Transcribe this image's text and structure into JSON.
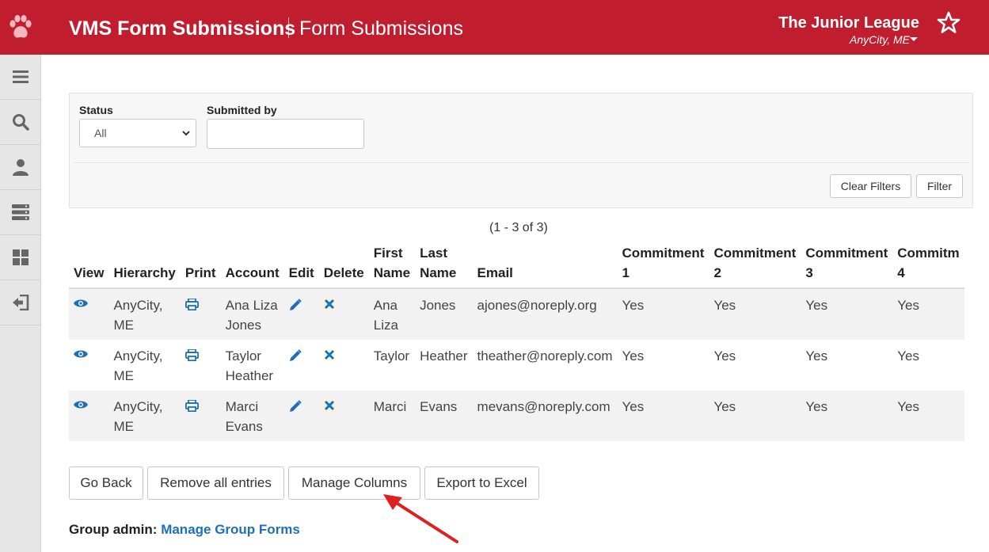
{
  "header": {
    "app_title": "VMS Form Submissions",
    "page_title": "Form Submissions",
    "org_name": "The Junior League",
    "org_city": "AnyCity, ME"
  },
  "sidebar": {
    "icons": [
      "menu-icon",
      "search-icon",
      "user-icon",
      "server-icon",
      "dashboard-icon",
      "logout-icon"
    ]
  },
  "filters": {
    "status_label": "Status",
    "status_value": "All",
    "submitted_by_label": "Submitted by",
    "submitted_by_value": "",
    "clear_label": "Clear Filters",
    "filter_label": "Filter"
  },
  "results_count": "(1 - 3 of 3)",
  "table": {
    "headers": {
      "view": "View",
      "hierarchy": "Hierarchy",
      "print": "Print",
      "account": "Account",
      "edit": "Edit",
      "delete": "Delete",
      "first_1": "First",
      "first_2": "Name",
      "last_1": "Last",
      "last_2": "Name",
      "email": "Email",
      "c1_1": "Commitment",
      "c1_2": "1",
      "c2_1": "Commitment",
      "c2_2": "2",
      "c3_1": "Commitment",
      "c3_2": "3",
      "c4_1": "Commitm",
      "c4_2": "4"
    },
    "rows": [
      {
        "hier_1": "AnyCity,",
        "hier_2": "ME",
        "acct_1": "Ana Liza",
        "acct_2": "Jones",
        "first_1": "Ana",
        "first_2": "Liza",
        "last": "Jones",
        "email": "ajones@noreply.org",
        "c1": "Yes",
        "c2": "Yes",
        "c3": "Yes",
        "c4": "Yes"
      },
      {
        "hier_1": "AnyCity,",
        "hier_2": "ME",
        "acct_1": "Taylor",
        "acct_2": "Heather",
        "first_1": "Taylor",
        "first_2": "",
        "last": "Heather",
        "email": "theather@noreply.com",
        "c1": "Yes",
        "c2": "Yes",
        "c3": "Yes",
        "c4": "Yes"
      },
      {
        "hier_1": "AnyCity,",
        "hier_2": "ME",
        "acct_1": "Marci",
        "acct_2": "Evans",
        "first_1": "Marci",
        "first_2": "",
        "last": "Evans",
        "email": "mevans@noreply.com",
        "c1": "Yes",
        "c2": "Yes",
        "c3": "Yes",
        "c4": "Yes"
      }
    ]
  },
  "actions": {
    "go_back": "Go Back",
    "remove_all": "Remove all entries",
    "manage_columns": "Manage Columns",
    "export_excel": "Export to Excel"
  },
  "footer": {
    "admin_label": "Group admin:",
    "admin_link": "Manage Group Forms"
  },
  "colors": {
    "brand_red": "#c01d2e",
    "link_blue": "#1f6fb5",
    "arrow_red": "#e02020"
  }
}
